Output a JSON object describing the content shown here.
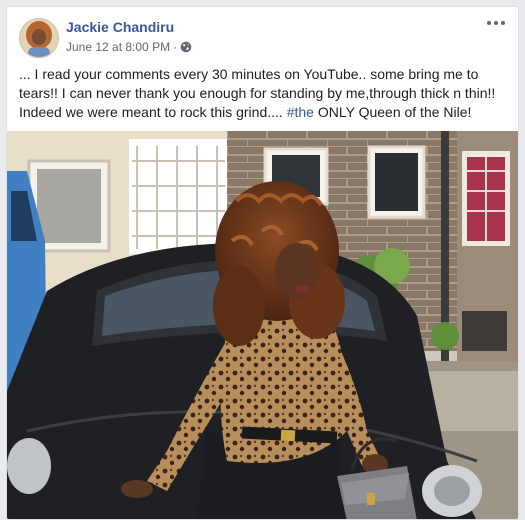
{
  "post": {
    "author_name": "Jackie Chandiru",
    "date": "June 12 at 8:00 PM",
    "separator": "·",
    "privacy_icon": "globe-icon",
    "more_icon": "more-options-icon",
    "text_before": "... I read your comments every 30 minutes on YouTube.. some bring me to tears!! I can never thank you enough for standing by me,through thick n thin!! Indeed we were meant to rock this grind.... ",
    "hashtag": "#the",
    "text_after": " ONLY Queen of the Nile!"
  },
  "colors": {
    "link": "#385898",
    "text": "#1c1e21",
    "meta": "#616770",
    "background": "#e9ebee"
  }
}
